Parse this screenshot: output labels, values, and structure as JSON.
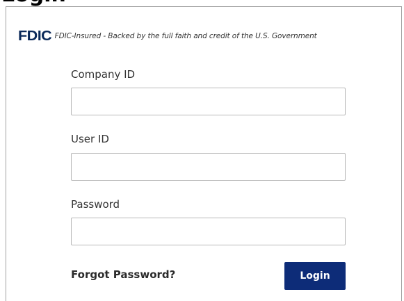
{
  "header": {
    "heading_fragment": "Login"
  },
  "fdic_banner": {
    "logo_text": "FDIC",
    "statement": "FDIC-Insured - Backed by the full faith and credit of the U.S. Government"
  },
  "form": {
    "company_id": {
      "label": "Company ID",
      "value": "",
      "placeholder": ""
    },
    "user_id": {
      "label": "User ID",
      "value": "",
      "placeholder": ""
    },
    "password": {
      "label": "Password",
      "value": "",
      "placeholder": ""
    },
    "forgot_password_label": "Forgot Password?",
    "login_button_label": "Login"
  },
  "colors": {
    "fdic_navy": "#0b2a5a",
    "login_button_bg": "#0d2c78",
    "border": "#b8b8b8"
  }
}
